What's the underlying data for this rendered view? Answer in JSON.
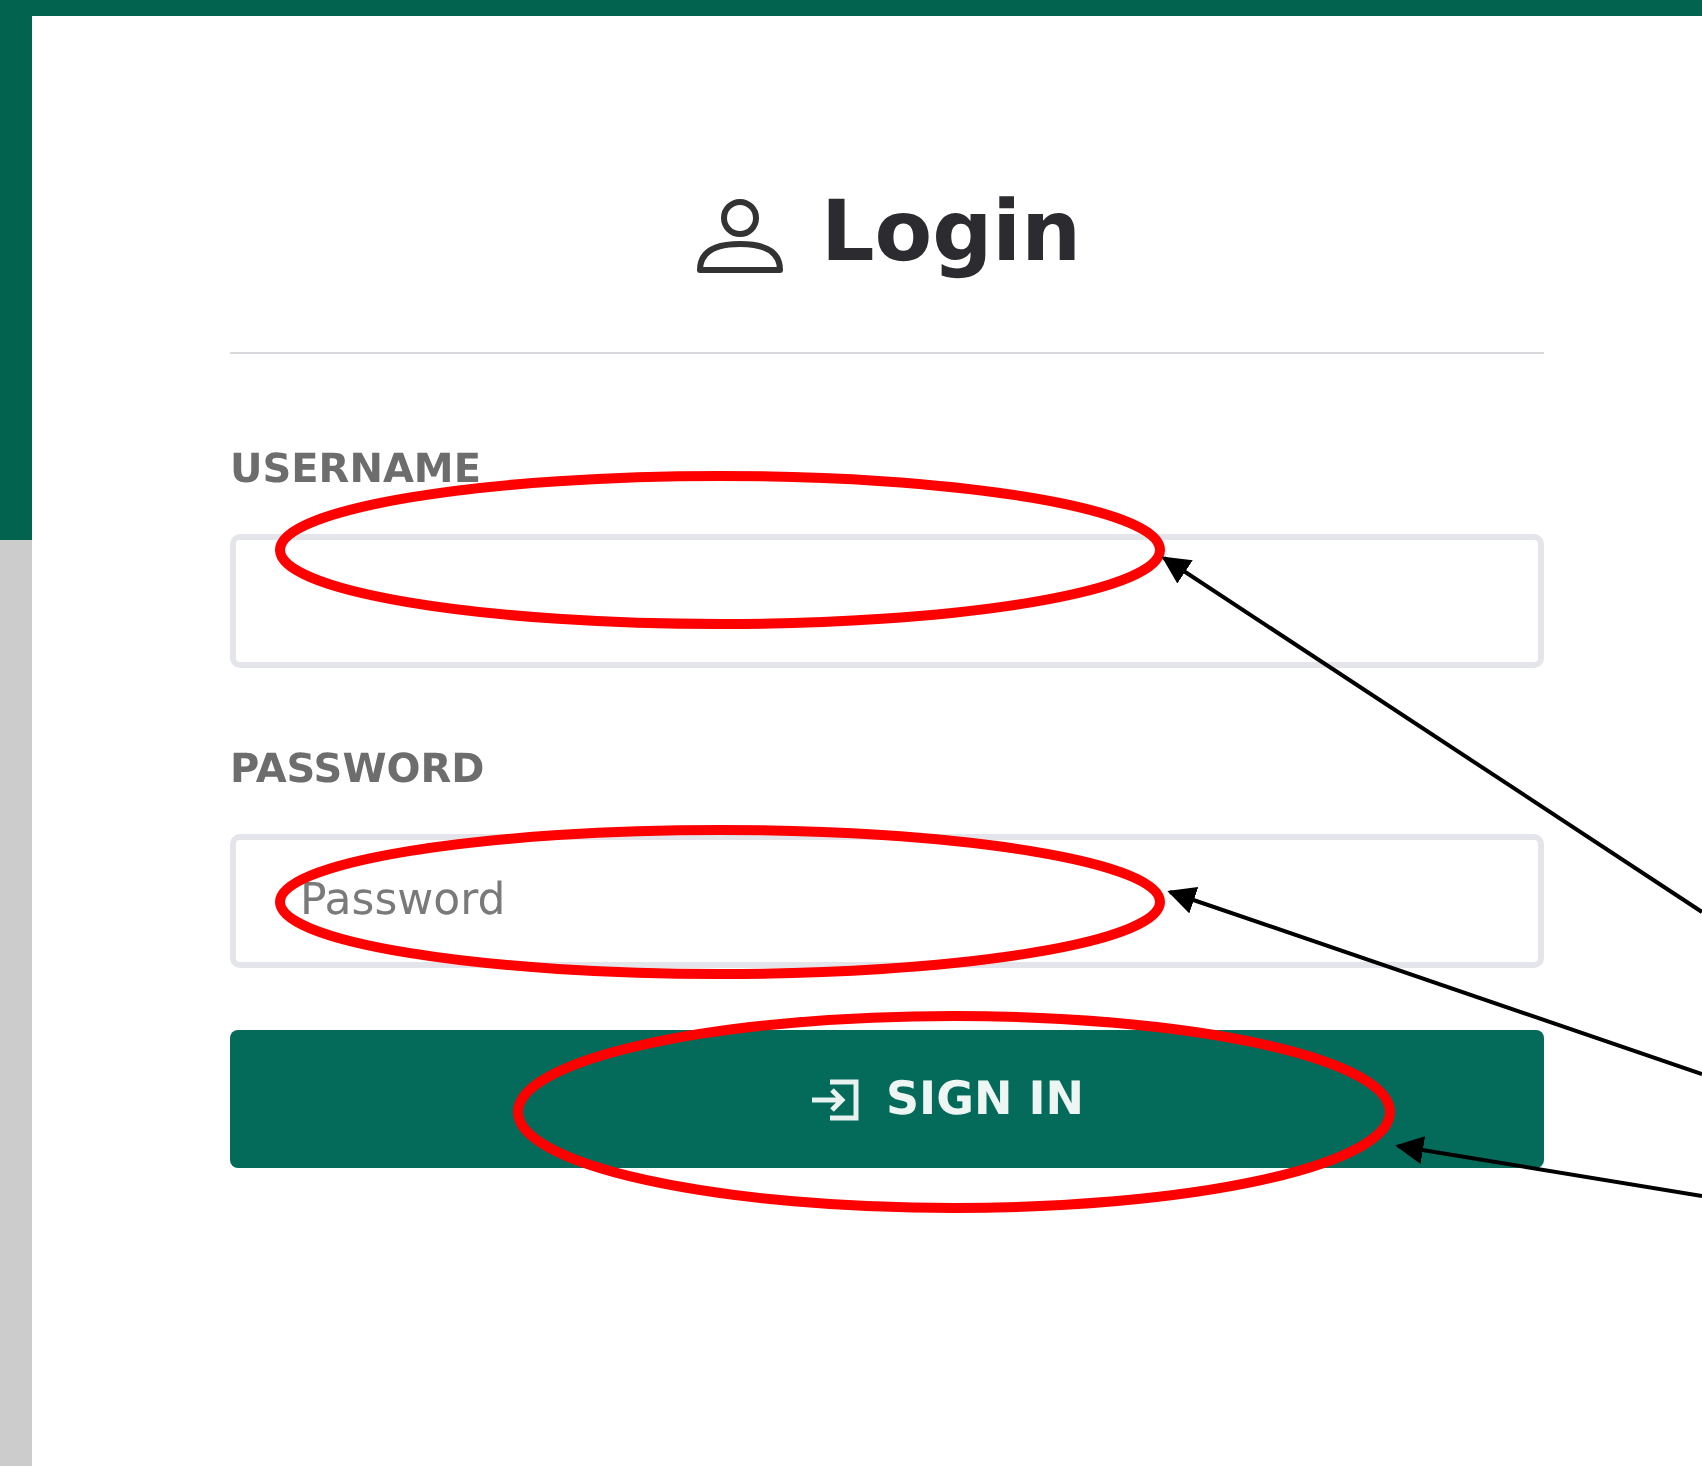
{
  "title": "Login",
  "fields": [
    {
      "label": "USERNAME",
      "highlighted": true
    },
    {
      "label": "PASSWORD",
      "placeholder": "Password",
      "highlighted": true
    }
  ],
  "button": {
    "label": "SIGN IN",
    "highlighted": true
  }
}
